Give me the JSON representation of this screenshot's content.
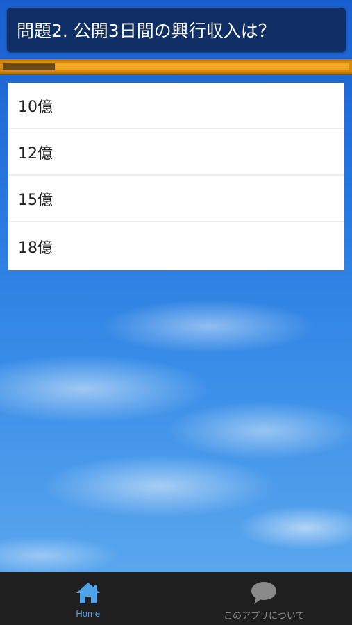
{
  "question": {
    "text": "問題2. 公開3日間の興行収入は？"
  },
  "progress": {
    "fraction": 0.15
  },
  "answers": [
    {
      "label": "10億"
    },
    {
      "label": "12億"
    },
    {
      "label": "15億"
    },
    {
      "label": "18億"
    }
  ],
  "bottom_nav": {
    "tabs": [
      {
        "label": "Home",
        "icon": "home-icon",
        "active": true
      },
      {
        "label": "このアプリについて",
        "icon": "speech-bubble-icon",
        "active": false
      }
    ]
  },
  "colors": {
    "header_bg": "#0f2f66",
    "progress_track": "#f0a623",
    "progress_fill": "#6b4a1a",
    "active_tab": "#4fa3ea",
    "inactive_tab": "#8a8a8a",
    "nav_bg": "#1f1f1f"
  }
}
